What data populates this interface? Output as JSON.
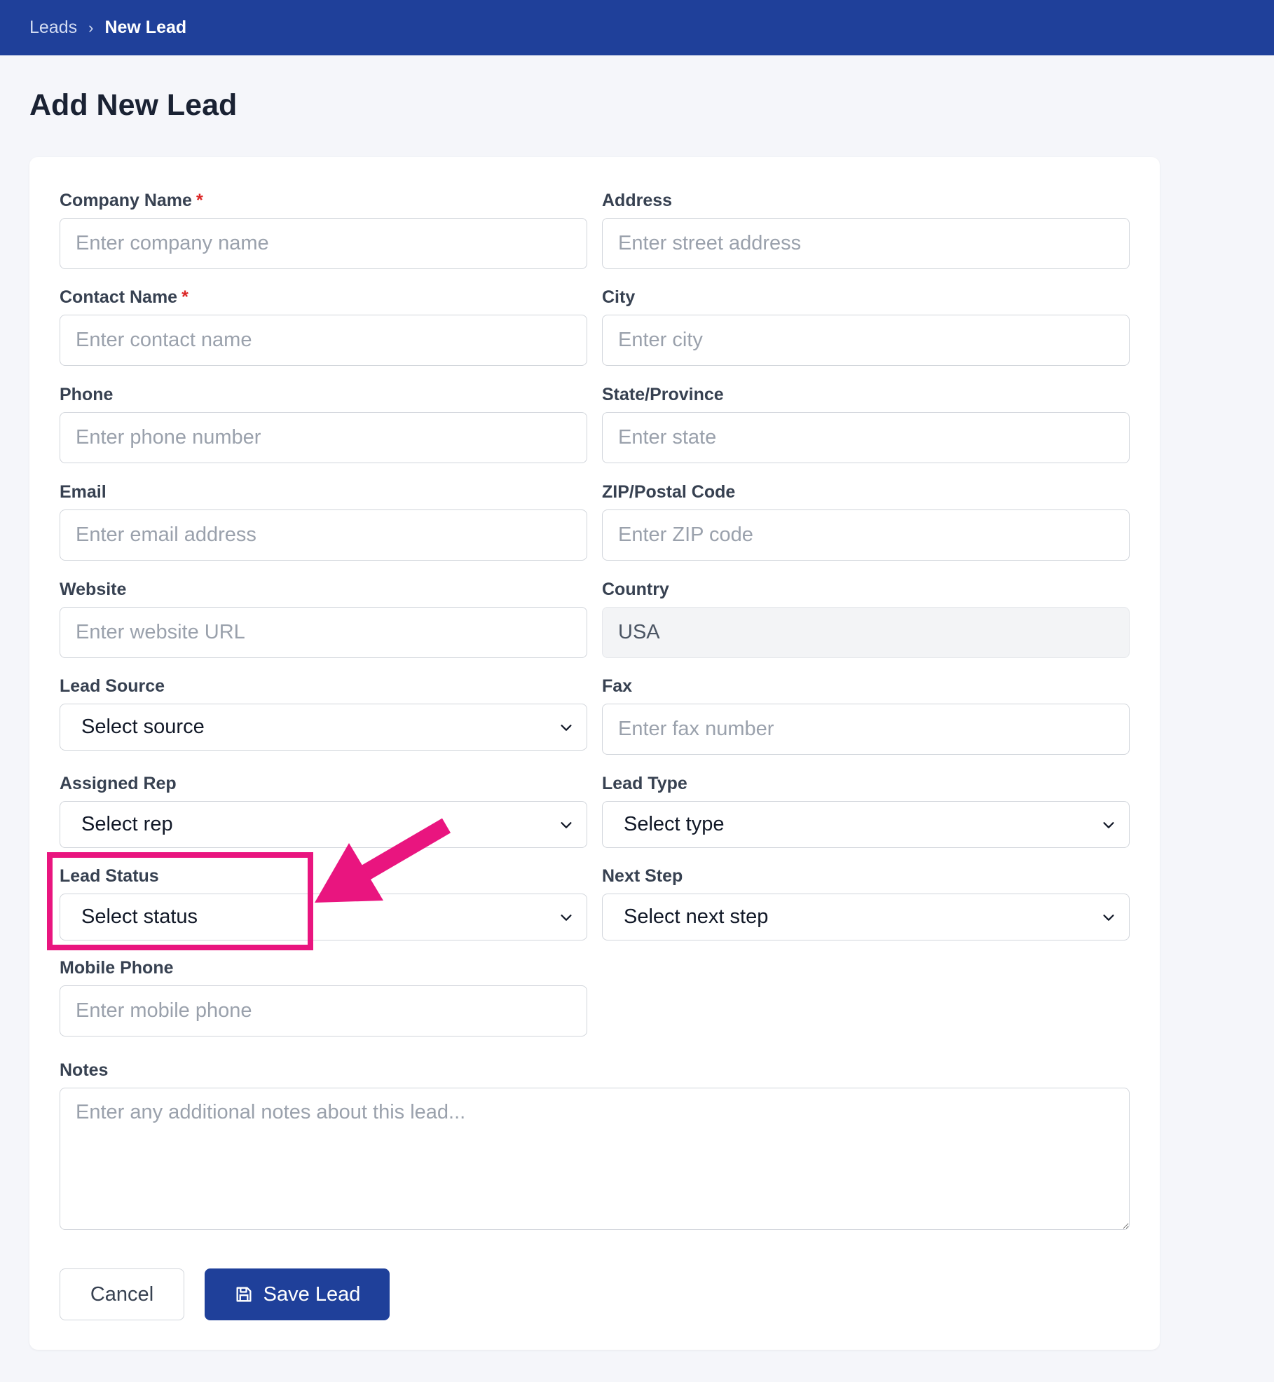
{
  "breadcrumb": {
    "parent": "Leads",
    "separator": "›",
    "current": "New Lead"
  },
  "page": {
    "title": "Add New Lead"
  },
  "form": {
    "required_marker": "*",
    "company_name": {
      "label": "Company Name",
      "placeholder": "Enter company name"
    },
    "contact_name": {
      "label": "Contact Name",
      "placeholder": "Enter contact name"
    },
    "phone": {
      "label": "Phone",
      "placeholder": "Enter phone number"
    },
    "email": {
      "label": "Email",
      "placeholder": "Enter email address"
    },
    "website": {
      "label": "Website",
      "placeholder": "Enter website URL"
    },
    "lead_source": {
      "label": "Lead Source",
      "value": "Select source"
    },
    "assigned_rep": {
      "label": "Assigned Rep",
      "value": "Select rep"
    },
    "lead_status": {
      "label": "Lead Status",
      "value": "Select status"
    },
    "mobile_phone": {
      "label": "Mobile Phone",
      "placeholder": "Enter mobile phone"
    },
    "address": {
      "label": "Address",
      "placeholder": "Enter street address"
    },
    "city": {
      "label": "City",
      "placeholder": "Enter city"
    },
    "state": {
      "label": "State/Province",
      "placeholder": "Enter state"
    },
    "zip": {
      "label": "ZIP/Postal Code",
      "placeholder": "Enter ZIP code"
    },
    "country": {
      "label": "Country",
      "value": "USA"
    },
    "fax": {
      "label": "Fax",
      "placeholder": "Enter fax number"
    },
    "lead_type": {
      "label": "Lead Type",
      "value": "Select type"
    },
    "next_step": {
      "label": "Next Step",
      "value": "Select next step"
    },
    "notes": {
      "label": "Notes",
      "placeholder": "Enter any additional notes about this lead..."
    }
  },
  "actions": {
    "cancel_label": "Cancel",
    "save_label": "Save Lead",
    "save_icon": "save-icon"
  },
  "colors": {
    "header": "#1f409a",
    "primary_button": "#1f409a",
    "annotation": "#e9157f",
    "required": "#dc2626"
  }
}
